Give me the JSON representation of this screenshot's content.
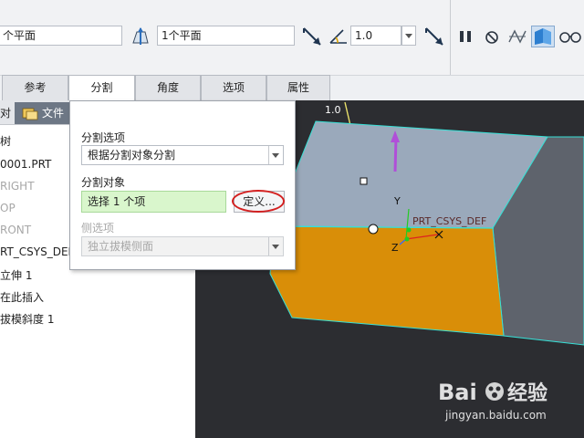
{
  "toolbar": {
    "ref_field_1": "个平面",
    "ref_field_2": "1个平面",
    "offset_value": "1.0",
    "icons": [
      "flip-direction-icon",
      "split-surface-icon",
      "flip-icon",
      "angle-icon",
      "dropdown-icon",
      "flip-angle-icon",
      "pause-icon",
      "stop-icon",
      "preview-icon",
      "verify-icon",
      "glasses-icon"
    ]
  },
  "tabs": [
    {
      "label": "参考"
    },
    {
      "label": "分割"
    },
    {
      "label": "角度"
    },
    {
      "label": "选项"
    },
    {
      "label": "属性"
    }
  ],
  "left_panel": {
    "tab_model_tree": "对",
    "tab_file": "文件",
    "header": "树",
    "items": [
      {
        "label": "0001.PRT",
        "dim": false
      },
      {
        "label": "RIGHT",
        "dim": true
      },
      {
        "label": "OP",
        "dim": true
      },
      {
        "label": "RONT",
        "dim": true
      },
      {
        "label": "RT_CSYS_DEF",
        "dim": false
      },
      {
        "label": "立伸 1",
        "dim": false
      },
      {
        "label": "在此插入",
        "dim": false
      },
      {
        "label": "拔模斜度 1",
        "dim": false
      }
    ]
  },
  "split_panel": {
    "split_options_label": "分割选项",
    "split_options_value": "根据分割对象分割",
    "split_object_label": "分割对象",
    "split_object_value": "选择 1 个项",
    "define_button": "定义...",
    "side_options_label": "侧选项",
    "side_options_value": "独立拔模侧面"
  },
  "viewport": {
    "dimension_label": "1.0",
    "csys_label": "PRT_CSYS_DEF",
    "axis_y": "Y",
    "axis_z": "Z",
    "axis_x": "X"
  },
  "watermark": {
    "brand": "Bai du 经验",
    "url": "jingyan.baidu.com"
  },
  "colors": {
    "top_face": "#9aa9bb",
    "front_face": "#d98e08",
    "side_face": "#5e636c",
    "edge": "#37e0d6",
    "highlight_circle": "#d32020",
    "drag_arrow": "#b04fd8"
  }
}
